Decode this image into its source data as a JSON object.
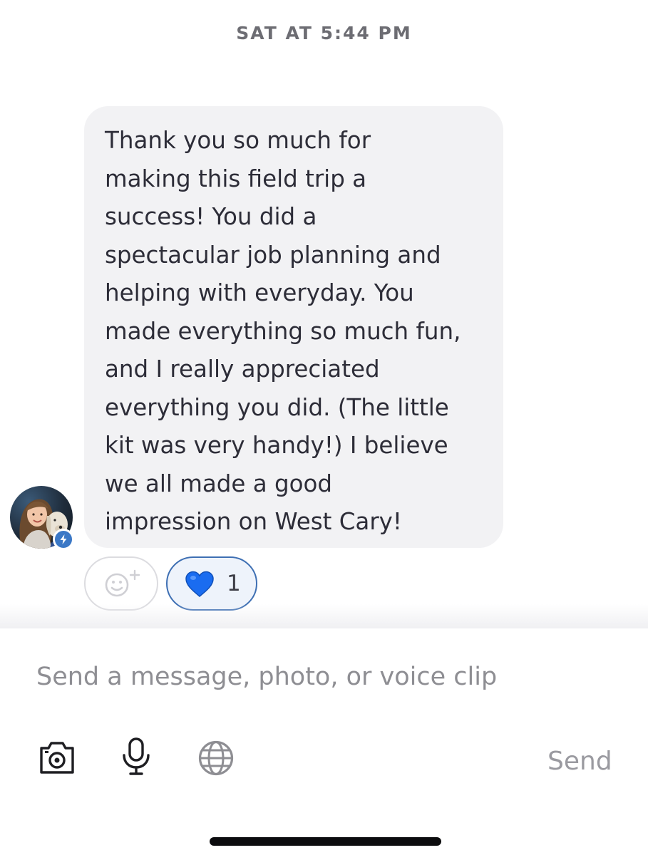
{
  "thread": {
    "timestamp": "SAT AT 5:44 PM"
  },
  "message": {
    "lines": [
      "Thank you so much for",
      "making this field trip a",
      "success! You did a",
      "spectacular job planning and",
      "helping with everyday. You",
      "made everything so much fun,",
      "and I really appreciated",
      "everything you did. (The little",
      "kit was very handy!) I believe",
      "we all made a good",
      "impression on West Cary!"
    ],
    "sender_badge_icon": "lightning-bolt-icon"
  },
  "reactions": {
    "add_icon": "add-reaction-icon",
    "heart": {
      "emoji": "💙",
      "count": "1"
    }
  },
  "composer": {
    "placeholder": "Send a message, photo, or voice clip",
    "tools": [
      "camera-icon",
      "microphone-icon",
      "globe-icon"
    ],
    "send_label": "Send"
  },
  "colors": {
    "bubble": "#f2f2f4",
    "heart_border": "#3e6fb3",
    "badge": "#3b78c6"
  }
}
